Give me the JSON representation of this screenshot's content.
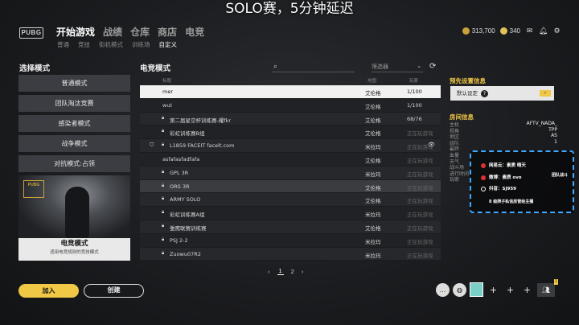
{
  "caption": "SOLO赛，5分钟延迟",
  "logo": "PUBG",
  "nav": {
    "main": [
      "开始游戏",
      "战绩",
      "仓库",
      "商店",
      "电竞"
    ],
    "sub": [
      "普通",
      "竞技",
      "街机模式",
      "训练场",
      "自定义"
    ]
  },
  "currency": {
    "bp": "313,700",
    "gcoin": "340"
  },
  "left": {
    "title": "选择模式",
    "modes": [
      "普通模式",
      "团队淘汰竞赛",
      "感染者模式",
      "战争模式",
      "对抗模式:占领"
    ],
    "card": {
      "badge": "PUBG",
      "title": "电竞模式",
      "subtitle": "适用电竞规则的竞技模式"
    }
  },
  "list": {
    "title": "电竞模式",
    "filter_placeholder": "筛选器",
    "headers": {
      "name": "标题",
      "map": "地图",
      "players": "玩家"
    },
    "rows": [
      {
        "name": "mer",
        "map": "艾伦格",
        "players": "1/100",
        "locked": false
      },
      {
        "name": "wut",
        "map": "艾伦格",
        "players": "1/100",
        "locked": false
      },
      {
        "name": "第二届星空杯训练赛-耀fkr",
        "map": "艾伦格",
        "players": "68/76",
        "locked": true
      },
      {
        "name": "彩虹训练赛B组",
        "map": "艾伦格",
        "players": "正在玩游戏",
        "locked": true
      },
      {
        "name": "L1859 FACEIT facelt.com",
        "map": "米拉玛",
        "players": "正在玩游戏",
        "locked": true
      },
      {
        "name": "asfafasfadfafa",
        "map": "艾伦格",
        "players": "正在玩游戏",
        "locked": false
      },
      {
        "name": "GPL 3R",
        "map": "米拉玛",
        "players": "正在玩游戏",
        "locked": true
      },
      {
        "name": "ORS 3R",
        "map": "艾伦格",
        "players": "正在玩游戏",
        "locked": true
      },
      {
        "name": "ARMY SOLO",
        "map": "艾伦格",
        "players": "正在玩游戏",
        "locked": true
      },
      {
        "name": "彩虹训练赛A组",
        "map": "米拉玛",
        "players": "正在玩游戏",
        "locked": true
      },
      {
        "name": "雏鹰联赛训练赛",
        "map": "艾伦格",
        "players": "正在玩游戏",
        "locked": true
      },
      {
        "name": "PSJ 2-2",
        "map": "米拉玛",
        "players": "正在玩游戏",
        "locked": true
      },
      {
        "name": "Zuowu07R2",
        "map": "米拉玛",
        "players": "正在玩游戏",
        "locked": true
      }
    ],
    "pages": [
      "1",
      "2"
    ]
  },
  "right": {
    "preset_title": "预先设置信息",
    "preset_value": "默认设定",
    "room_title": "房间信息",
    "room_rows": [
      {
        "k": "主机",
        "v": "AFTV_NADA_"
      },
      {
        "k": "视角",
        "v": "TPP"
      },
      {
        "k": "地区",
        "v": "AS"
      },
      {
        "k": "组队",
        "v": "1"
      },
      {
        "k": "最终",
        "v": ""
      },
      {
        "k": "血量",
        "v": ""
      },
      {
        "k": "天气",
        "v": ""
      },
      {
        "k": "战斗场",
        "v": ""
      },
      {
        "k": "进行时间",
        "v": ""
      },
      {
        "k": "玩家",
        "v": ""
      }
    ]
  },
  "overlay": {
    "lines": [
      "网易云：素质 晴天",
      "微博：素质 ovo",
      "抖音：SJ959",
      "8 级牌子私信房管给主播"
    ],
    "tag": "团队战斗"
  },
  "buttons": {
    "join": "加入",
    "create": "创建"
  }
}
